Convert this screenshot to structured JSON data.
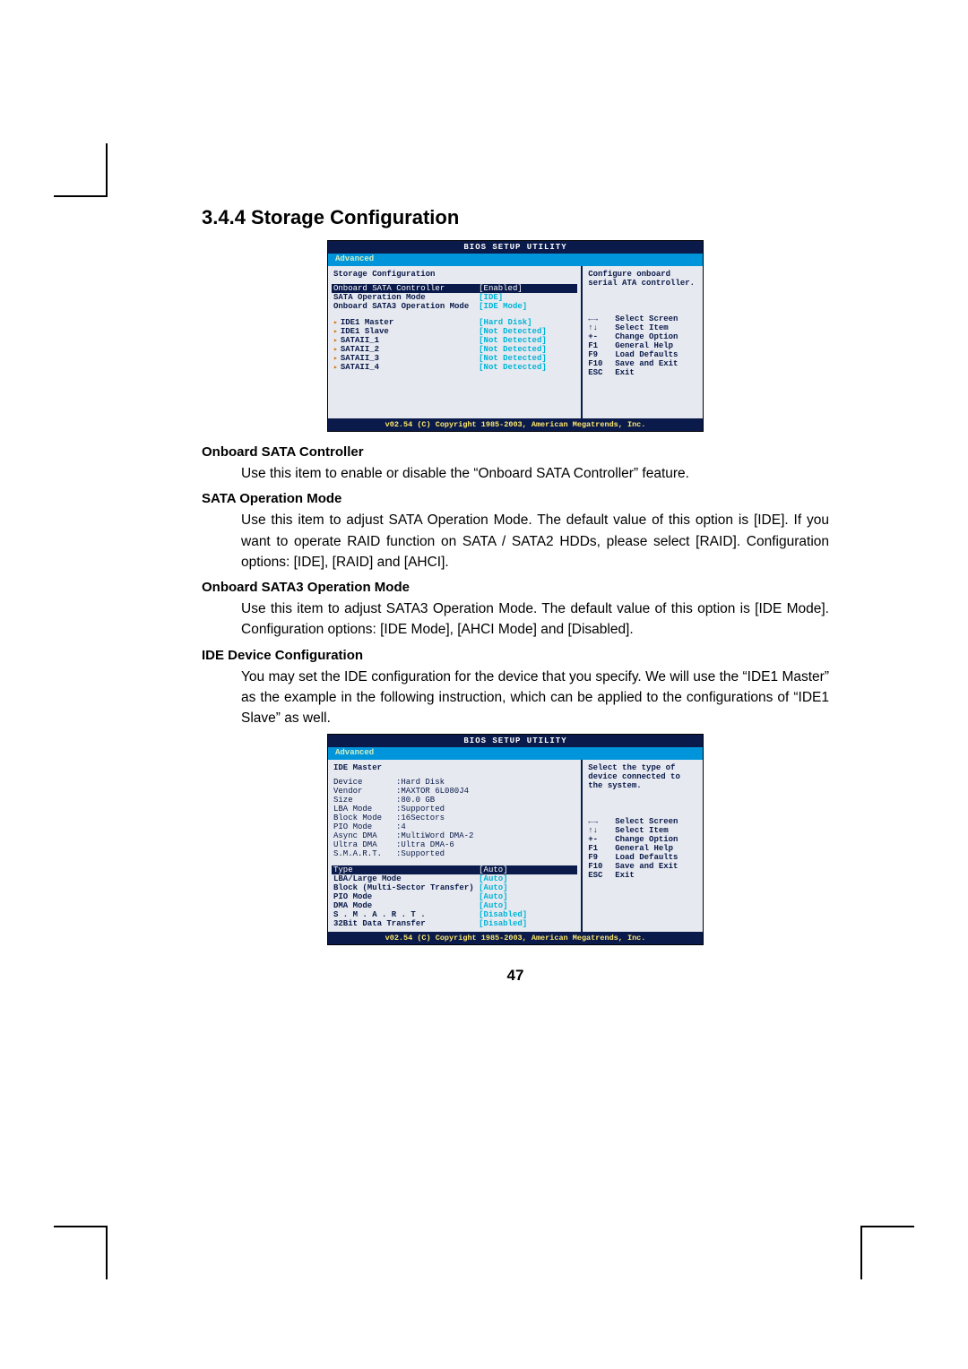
{
  "section_title": "3.4.4 Storage Configuration",
  "page_number": "47",
  "bios1": {
    "title": "BIOS SETUP UTILITY",
    "tab": "Advanced",
    "heading": "Storage Configuration",
    "rows": [
      {
        "k": "Onboard SATA Controller",
        "v": "[Enabled]",
        "highlight": true
      },
      {
        "k": "SATA Operation Mode",
        "v": "[IDE]"
      },
      {
        "k": "Onboard SATA3 Operation Mode",
        "v": "[IDE Mode]"
      }
    ],
    "drives": [
      {
        "k": "IDE1 Master",
        "v": "[Hard Disk]"
      },
      {
        "k": "IDE1 Slave",
        "v": "[Not Detected]"
      },
      {
        "k": "SATAII_1",
        "v": "[Not Detected]"
      },
      {
        "k": "SATAII_2",
        "v": "[Not Detected]"
      },
      {
        "k": "SATAII_3",
        "v": "[Not Detected]"
      },
      {
        "k": "SATAII_4",
        "v": "[Not Detected]"
      }
    ],
    "help_top": "Configure onboard serial ATA controller.",
    "help_keys": [
      {
        "k": "←→",
        "v": "Select Screen"
      },
      {
        "k": "↑↓",
        "v": "Select Item"
      },
      {
        "k": "+-",
        "v": "Change Option"
      },
      {
        "k": "F1",
        "v": "General Help"
      },
      {
        "k": "F9",
        "v": "Load Defaults"
      },
      {
        "k": "F10",
        "v": "Save and Exit"
      },
      {
        "k": "ESC",
        "v": "Exit"
      }
    ],
    "footer": "v02.54 (C) Copyright 1985-2003, American Megatrends, Inc."
  },
  "items": [
    {
      "title": "Onboard SATA Controller",
      "body": "Use this item to enable or disable the “Onboard SATA Controller” feature."
    },
    {
      "title": "SATA Operation Mode",
      "body": "Use this item to adjust SATA Operation Mode. The default value of this option is [IDE]. If you want to operate RAID function on SATA / SATA2 HDDs, please select [RAID]. Configuration options: [IDE], [RAID] and [AHCI]."
    },
    {
      "title": "Onboard SATA3 Operation Mode",
      "body": "Use this item to adjust SATA3 Operation Mode. The default value of this option is [IDE Mode]. Configuration options: [IDE Mode], [AHCI Mode] and [Disabled]."
    },
    {
      "title": "IDE Device Configuration",
      "body": "You may set the IDE configuration for the device that you specify. We will use the “IDE1 Master” as the example in the following instruction, which can be applied to the configurations of “IDE1 Slave” as well."
    }
  ],
  "bios2": {
    "title": "BIOS SETUP UTILITY",
    "tab": "Advanced",
    "heading": "IDE Master",
    "info": [
      {
        "k": "Device",
        "v": ":Hard Disk"
      },
      {
        "k": "Vendor",
        "v": ":MAXTOR 6L080J4"
      },
      {
        "k": "Size",
        "v": ":80.0 GB"
      },
      {
        "k": "LBA Mode",
        "v": ":Supported"
      },
      {
        "k": "Block Mode",
        "v": ":16Sectors"
      },
      {
        "k": "PIO Mode",
        "v": ":4"
      },
      {
        "k": "Async DMA",
        "v": ":MultiWord DMA-2"
      },
      {
        "k": "Ultra DMA",
        "v": ":Ultra DMA-6"
      },
      {
        "k": "S.M.A.R.T.",
        "v": ":Supported"
      }
    ],
    "opts": [
      {
        "k": "Type",
        "v": "[Auto]",
        "highlight": true
      },
      {
        "k": "LBA/Large Mode",
        "v": "[Auto]"
      },
      {
        "k": "Block (Multi-Sector Transfer)",
        "v": "[Auto]"
      },
      {
        "k": "PIO Mode",
        "v": "[Auto]"
      },
      {
        "k": "DMA Mode",
        "v": "[Auto]"
      },
      {
        "k": "S . M . A . R . T .",
        "v": "[Disabled]"
      },
      {
        "k": "32Bit Data Transfer",
        "v": "[Disabled]"
      }
    ],
    "help_top": "Select the type of device connected to the system.",
    "help_keys": [
      {
        "k": "←→",
        "v": "Select Screen"
      },
      {
        "k": "↑↓",
        "v": "Select Item"
      },
      {
        "k": "+-",
        "v": "Change Option"
      },
      {
        "k": "F1",
        "v": "General Help"
      },
      {
        "k": "F9",
        "v": "Load Defaults"
      },
      {
        "k": "F10",
        "v": "Save and Exit"
      },
      {
        "k": "ESC",
        "v": "Exit"
      }
    ],
    "footer": "v02.54 (C) Copyright 1985-2003, American Megatrends, Inc."
  }
}
